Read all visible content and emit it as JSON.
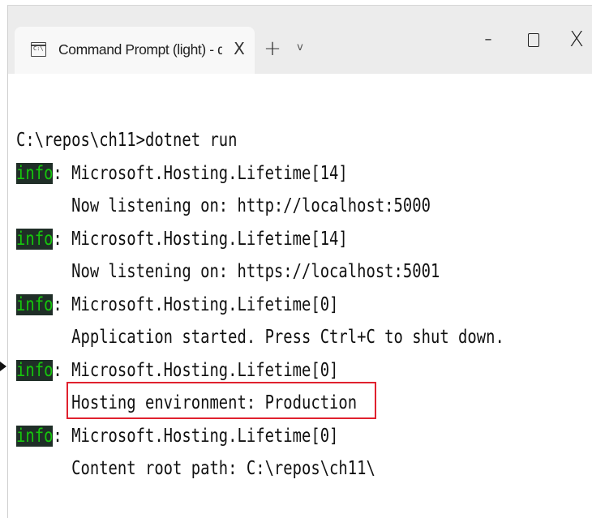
{
  "tab": {
    "title": "Command Prompt (light) - dot",
    "icon": "cmd-icon",
    "close_glyph": "X"
  },
  "titlebar": {
    "new_tab_glyph": "+",
    "dropdown_glyph": "v",
    "minimize_glyph": "–",
    "close_glyph": "X"
  },
  "terminal": {
    "prompt_line": "C:\\repos\\ch11>dotnet run",
    "info_tag": "info",
    "entries": [
      {
        "source": ": Microsoft.Hosting.Lifetime[14]",
        "message": "      Now listening on: http://localhost:5000"
      },
      {
        "source": ": Microsoft.Hosting.Lifetime[14]",
        "message": "      Now listening on: https://localhost:5001"
      },
      {
        "source": ": Microsoft.Hosting.Lifetime[0]",
        "message": "      Application started. Press Ctrl+C to shut down."
      },
      {
        "source": ": Microsoft.Hosting.Lifetime[0]",
        "message": "      Hosting environment: Production"
      },
      {
        "source": ": Microsoft.Hosting.Lifetime[0]",
        "message": "      Content root path: C:\\repos\\ch11\\"
      }
    ]
  },
  "colors": {
    "info_fg": "#16c60c",
    "info_bg": "#1f2e27",
    "highlight": "#e0212e"
  }
}
